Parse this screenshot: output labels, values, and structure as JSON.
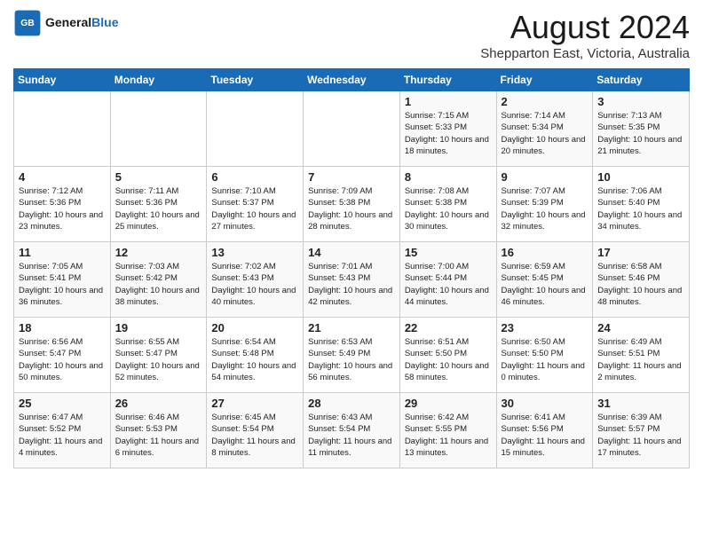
{
  "header": {
    "logo_line1": "General",
    "logo_line2": "Blue",
    "title": "August 2024",
    "subtitle": "Shepparton East, Victoria, Australia"
  },
  "weekdays": [
    "Sunday",
    "Monday",
    "Tuesday",
    "Wednesday",
    "Thursday",
    "Friday",
    "Saturday"
  ],
  "weeks": [
    [
      {
        "day": "",
        "info": ""
      },
      {
        "day": "",
        "info": ""
      },
      {
        "day": "",
        "info": ""
      },
      {
        "day": "",
        "info": ""
      },
      {
        "day": "1",
        "info": "Sunrise: 7:15 AM\nSunset: 5:33 PM\nDaylight: 10 hours\nand 18 minutes."
      },
      {
        "day": "2",
        "info": "Sunrise: 7:14 AM\nSunset: 5:34 PM\nDaylight: 10 hours\nand 20 minutes."
      },
      {
        "day": "3",
        "info": "Sunrise: 7:13 AM\nSunset: 5:35 PM\nDaylight: 10 hours\nand 21 minutes."
      }
    ],
    [
      {
        "day": "4",
        "info": "Sunrise: 7:12 AM\nSunset: 5:36 PM\nDaylight: 10 hours\nand 23 minutes."
      },
      {
        "day": "5",
        "info": "Sunrise: 7:11 AM\nSunset: 5:36 PM\nDaylight: 10 hours\nand 25 minutes."
      },
      {
        "day": "6",
        "info": "Sunrise: 7:10 AM\nSunset: 5:37 PM\nDaylight: 10 hours\nand 27 minutes."
      },
      {
        "day": "7",
        "info": "Sunrise: 7:09 AM\nSunset: 5:38 PM\nDaylight: 10 hours\nand 28 minutes."
      },
      {
        "day": "8",
        "info": "Sunrise: 7:08 AM\nSunset: 5:38 PM\nDaylight: 10 hours\nand 30 minutes."
      },
      {
        "day": "9",
        "info": "Sunrise: 7:07 AM\nSunset: 5:39 PM\nDaylight: 10 hours\nand 32 minutes."
      },
      {
        "day": "10",
        "info": "Sunrise: 7:06 AM\nSunset: 5:40 PM\nDaylight: 10 hours\nand 34 minutes."
      }
    ],
    [
      {
        "day": "11",
        "info": "Sunrise: 7:05 AM\nSunset: 5:41 PM\nDaylight: 10 hours\nand 36 minutes."
      },
      {
        "day": "12",
        "info": "Sunrise: 7:03 AM\nSunset: 5:42 PM\nDaylight: 10 hours\nand 38 minutes."
      },
      {
        "day": "13",
        "info": "Sunrise: 7:02 AM\nSunset: 5:43 PM\nDaylight: 10 hours\nand 40 minutes."
      },
      {
        "day": "14",
        "info": "Sunrise: 7:01 AM\nSunset: 5:43 PM\nDaylight: 10 hours\nand 42 minutes."
      },
      {
        "day": "15",
        "info": "Sunrise: 7:00 AM\nSunset: 5:44 PM\nDaylight: 10 hours\nand 44 minutes."
      },
      {
        "day": "16",
        "info": "Sunrise: 6:59 AM\nSunset: 5:45 PM\nDaylight: 10 hours\nand 46 minutes."
      },
      {
        "day": "17",
        "info": "Sunrise: 6:58 AM\nSunset: 5:46 PM\nDaylight: 10 hours\nand 48 minutes."
      }
    ],
    [
      {
        "day": "18",
        "info": "Sunrise: 6:56 AM\nSunset: 5:47 PM\nDaylight: 10 hours\nand 50 minutes."
      },
      {
        "day": "19",
        "info": "Sunrise: 6:55 AM\nSunset: 5:47 PM\nDaylight: 10 hours\nand 52 minutes."
      },
      {
        "day": "20",
        "info": "Sunrise: 6:54 AM\nSunset: 5:48 PM\nDaylight: 10 hours\nand 54 minutes."
      },
      {
        "day": "21",
        "info": "Sunrise: 6:53 AM\nSunset: 5:49 PM\nDaylight: 10 hours\nand 56 minutes."
      },
      {
        "day": "22",
        "info": "Sunrise: 6:51 AM\nSunset: 5:50 PM\nDaylight: 10 hours\nand 58 minutes."
      },
      {
        "day": "23",
        "info": "Sunrise: 6:50 AM\nSunset: 5:50 PM\nDaylight: 11 hours\nand 0 minutes."
      },
      {
        "day": "24",
        "info": "Sunrise: 6:49 AM\nSunset: 5:51 PM\nDaylight: 11 hours\nand 2 minutes."
      }
    ],
    [
      {
        "day": "25",
        "info": "Sunrise: 6:47 AM\nSunset: 5:52 PM\nDaylight: 11 hours\nand 4 minutes."
      },
      {
        "day": "26",
        "info": "Sunrise: 6:46 AM\nSunset: 5:53 PM\nDaylight: 11 hours\nand 6 minutes."
      },
      {
        "day": "27",
        "info": "Sunrise: 6:45 AM\nSunset: 5:54 PM\nDaylight: 11 hours\nand 8 minutes."
      },
      {
        "day": "28",
        "info": "Sunrise: 6:43 AM\nSunset: 5:54 PM\nDaylight: 11 hours\nand 11 minutes."
      },
      {
        "day": "29",
        "info": "Sunrise: 6:42 AM\nSunset: 5:55 PM\nDaylight: 11 hours\nand 13 minutes."
      },
      {
        "day": "30",
        "info": "Sunrise: 6:41 AM\nSunset: 5:56 PM\nDaylight: 11 hours\nand 15 minutes."
      },
      {
        "day": "31",
        "info": "Sunrise: 6:39 AM\nSunset: 5:57 PM\nDaylight: 11 hours\nand 17 minutes."
      }
    ]
  ]
}
